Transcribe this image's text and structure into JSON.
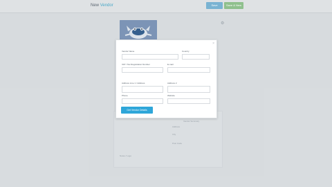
{
  "header": {
    "title_main": "New",
    "title_accent": "Vendor",
    "button_primary": "Save",
    "button_secondary": "Save & New"
  },
  "modal": {
    "close_glyph": "×",
    "fields": {
      "vendor_name": "Vendor Name",
      "country": "Country",
      "vat_number": "VAT / Tax Registration Number",
      "email": "E-mail",
      "address_line_1": "Address Line 1 / Address",
      "address_line_2": "Address 2",
      "phone": "Phone",
      "website": "Website"
    },
    "submit_label": "Get Vendor Details"
  },
  "background": {
    "label_1": "Vendor Summary",
    "label_2": "Address",
    "label_3": "City",
    "label_4": "Post Code",
    "label_5": "Notes / Logo",
    "settings_glyph": "⚙"
  },
  "icons": {
    "logo": "crab-mascot-logo",
    "close": "close-icon",
    "settings": "gear-icon"
  },
  "colors": {
    "accent": "#2ea6d9",
    "primary_button": "#79b3d2",
    "secondary_button": "#8fc08d",
    "logo_bg": "#7d97bb"
  }
}
